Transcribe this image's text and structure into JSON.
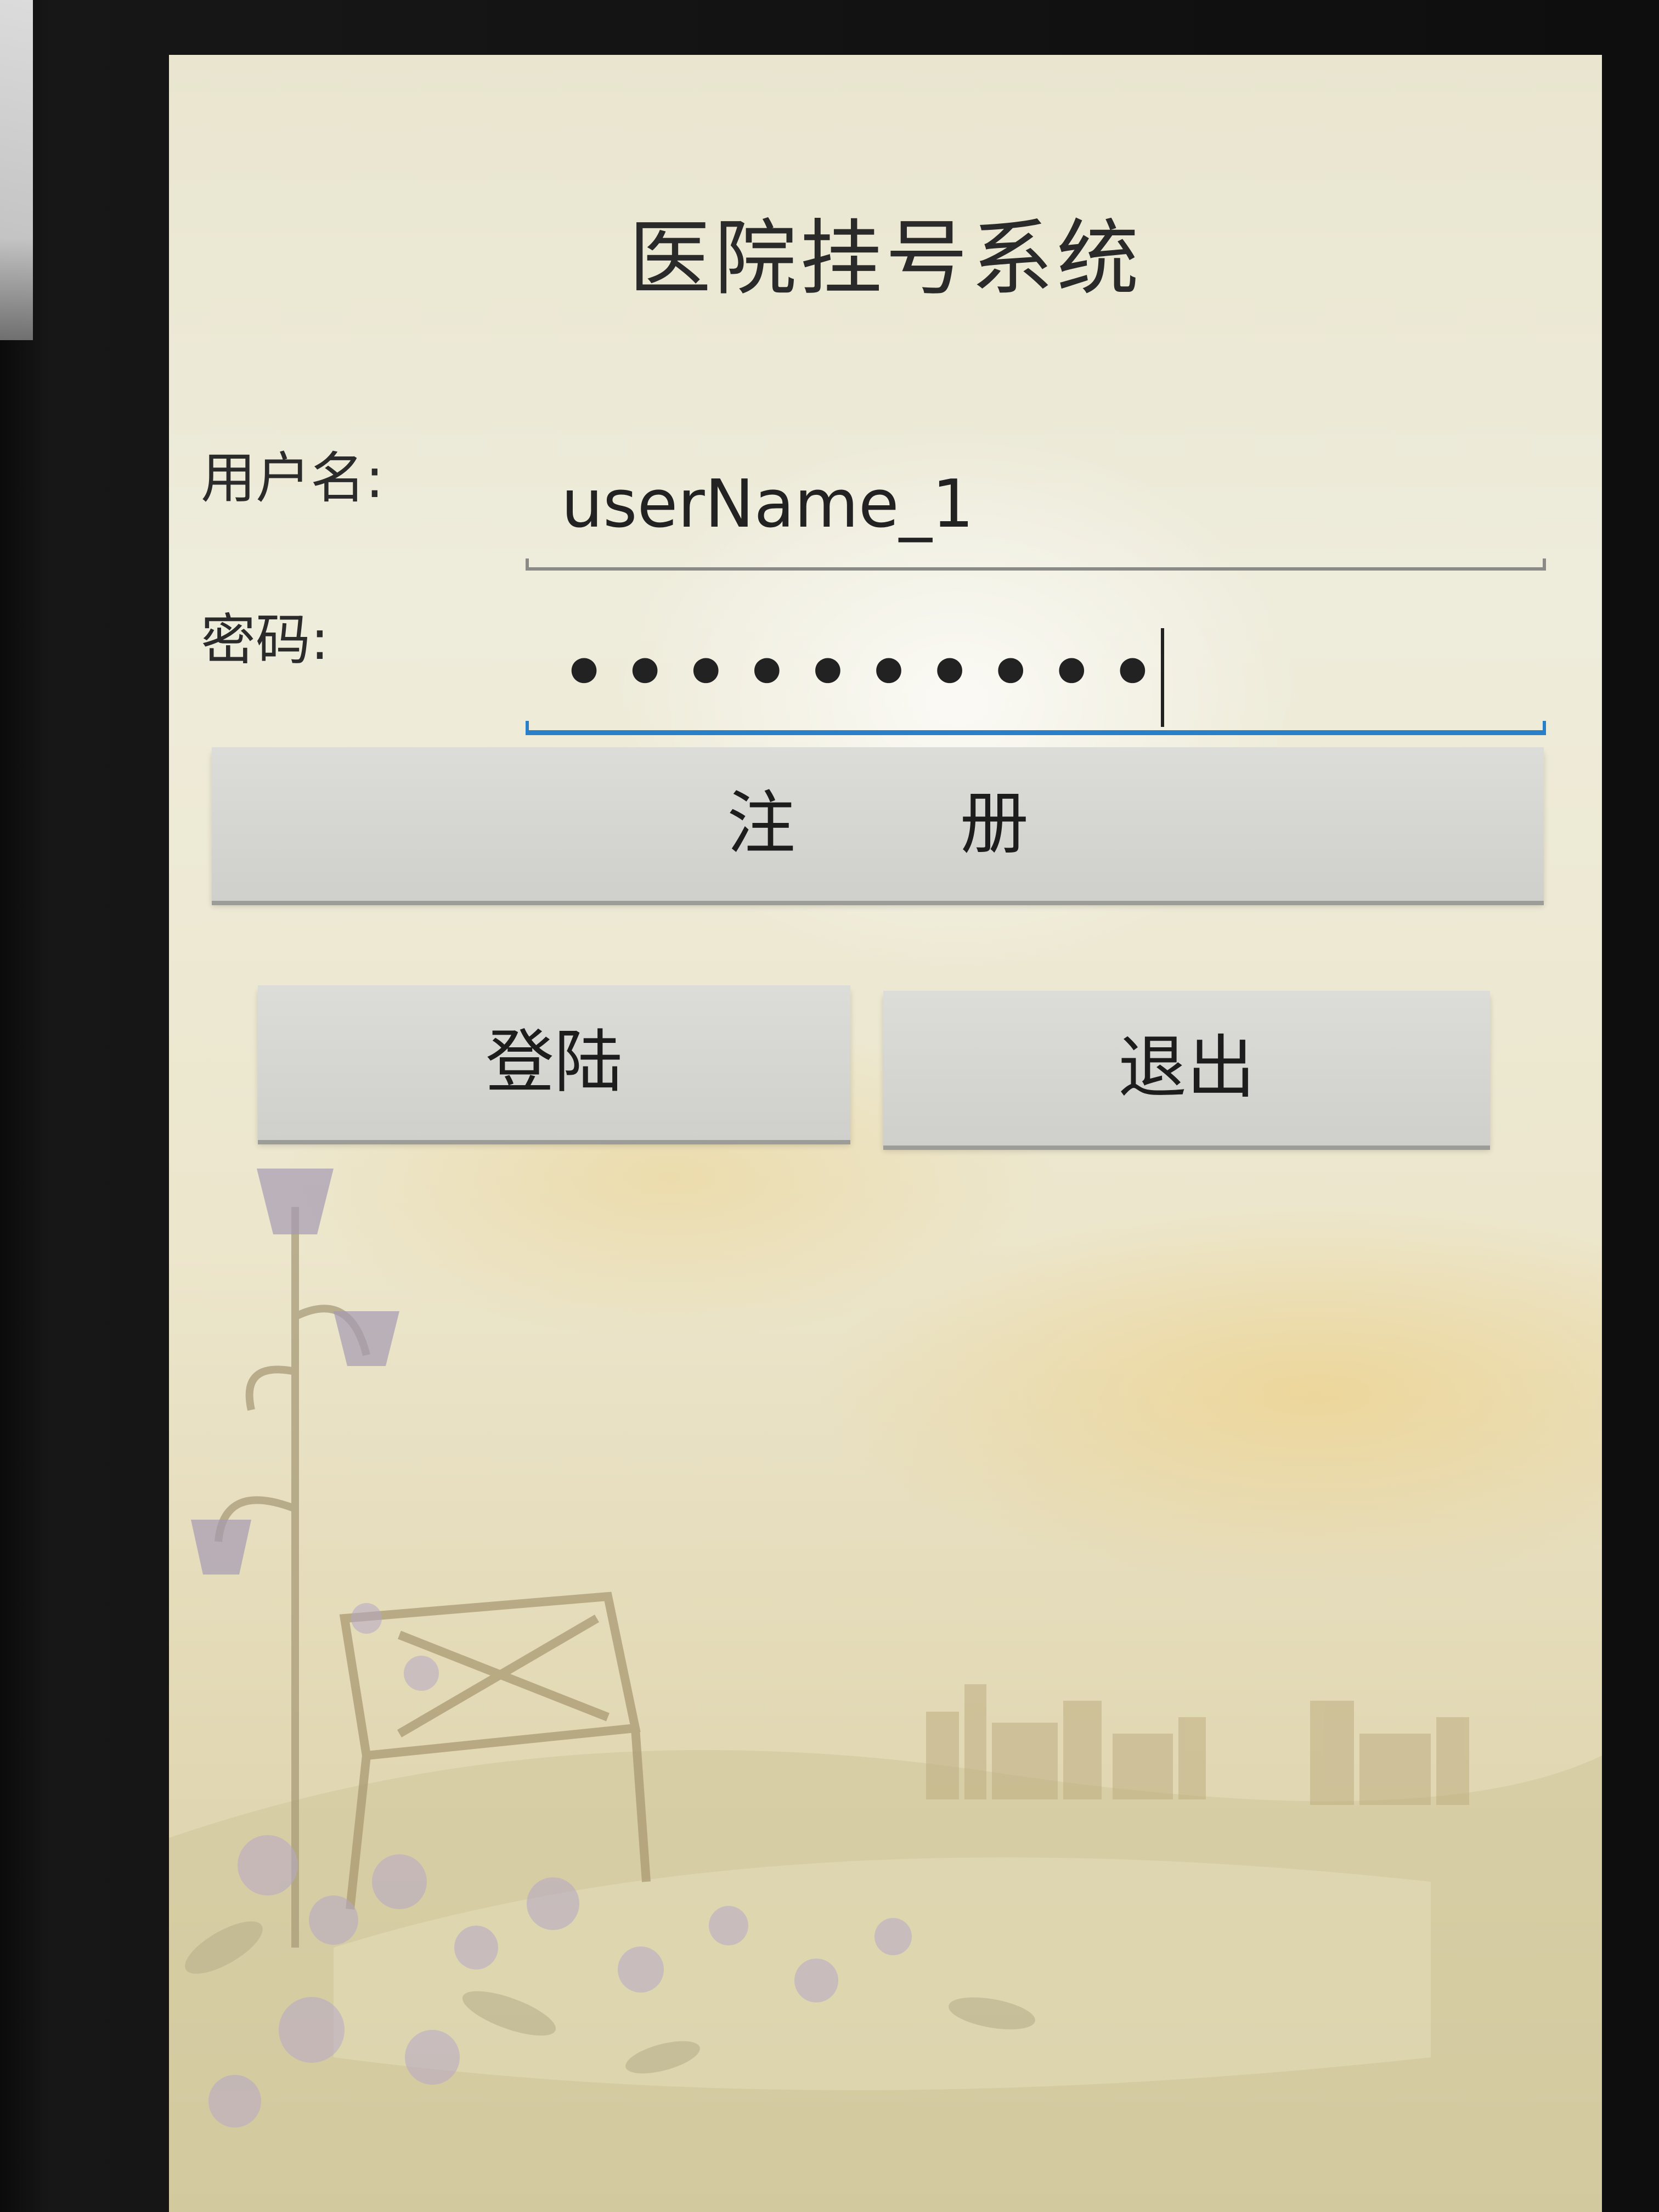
{
  "app": {
    "title": "医院挂号系统"
  },
  "form": {
    "username_label": "用户名:",
    "username_value": "userName_1",
    "password_label": "密码:",
    "password_masked": "••••••••••"
  },
  "buttons": {
    "register_label": "注册",
    "login_label": "登陆",
    "exit_label": "退出"
  },
  "colors": {
    "focused_underline": "#2a80c8",
    "field_underline": "#8a8a86",
    "button_background": "#d6d6d2"
  }
}
